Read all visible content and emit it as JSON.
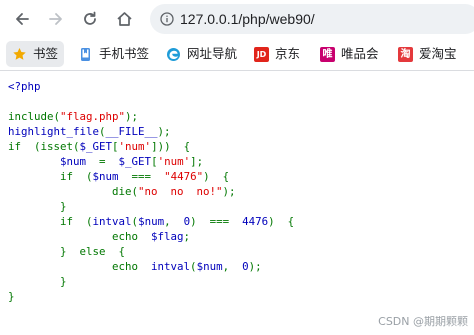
{
  "browser": {
    "address": "127.0.0.1/php/web90/"
  },
  "bookmarks": [
    {
      "label": "书签",
      "icon": "star-icon"
    },
    {
      "label": "手机书签",
      "icon": "mobile-bookmark-icon"
    },
    {
      "label": "网址导航",
      "icon": "edge-icon"
    },
    {
      "label": "京东",
      "icon": "jd-icon",
      "badge": "JD",
      "color": "#e1251b"
    },
    {
      "label": "唯品会",
      "icon": "vip-icon",
      "badge": "唯",
      "color": "#c8006e"
    },
    {
      "label": "爱淘宝",
      "icon": "taobao-icon",
      "badge": "淘",
      "color": "#e4393c"
    }
  ],
  "colors": {
    "php_default": "#0000BB",
    "php_keyword": "#007700",
    "php_string": "#DD0000",
    "star": "#f2a900",
    "edge": "#1f9cd8"
  },
  "code": {
    "open_tag": "<?php",
    "include_kw": "include(",
    "include_str": "\"flag.php\"",
    "include_end": ");",
    "hl_fn": "highlight_file",
    "hl_kw_open": "(",
    "hl_const": "__FILE__",
    "hl_kw_close": ");",
    "if1_kw": "if  (isset(",
    "if1_var": "$_GET",
    "if1_kw2": "[",
    "if1_str": "'num'",
    "if1_kw3": "]))  {",
    "assign_var": "$num",
    "assign_kw": "  =  ",
    "assign_var2": "$_GET",
    "assign_kw2": "[",
    "assign_str": "'num'",
    "assign_kw3": "];",
    "if2_kw": "if  (",
    "if2_var": "$num",
    "if2_kw2": "  ===  ",
    "if2_str": "\"4476\"",
    "if2_kw3": ")  {",
    "die_kw": "die(",
    "die_str": "\"no  no  no!\"",
    "die_end": ");",
    "close_brace1": "}",
    "if3_kw": "if  (",
    "if3_fn": "intval",
    "if3_kw2": "(",
    "if3_var": "$num",
    "if3_kw3": ",  ",
    "if3_num": "0",
    "if3_kw4": ")  ===  ",
    "if3_num2": "4476",
    "if3_kw5": ")  {",
    "echo1_kw": "echo  ",
    "echo1_var": "$flag",
    "echo1_end": ";",
    "else_kw": "}  else  {",
    "echo2_kw": "echo  ",
    "echo2_fn": "intval",
    "echo2_kw2": "(",
    "echo2_var": "$num",
    "echo2_kw3": ",  ",
    "echo2_num": "0",
    "echo2_end": ");",
    "close_brace2": "}",
    "close_brace3": "}"
  },
  "watermark": "CSDN @期期颗颗"
}
